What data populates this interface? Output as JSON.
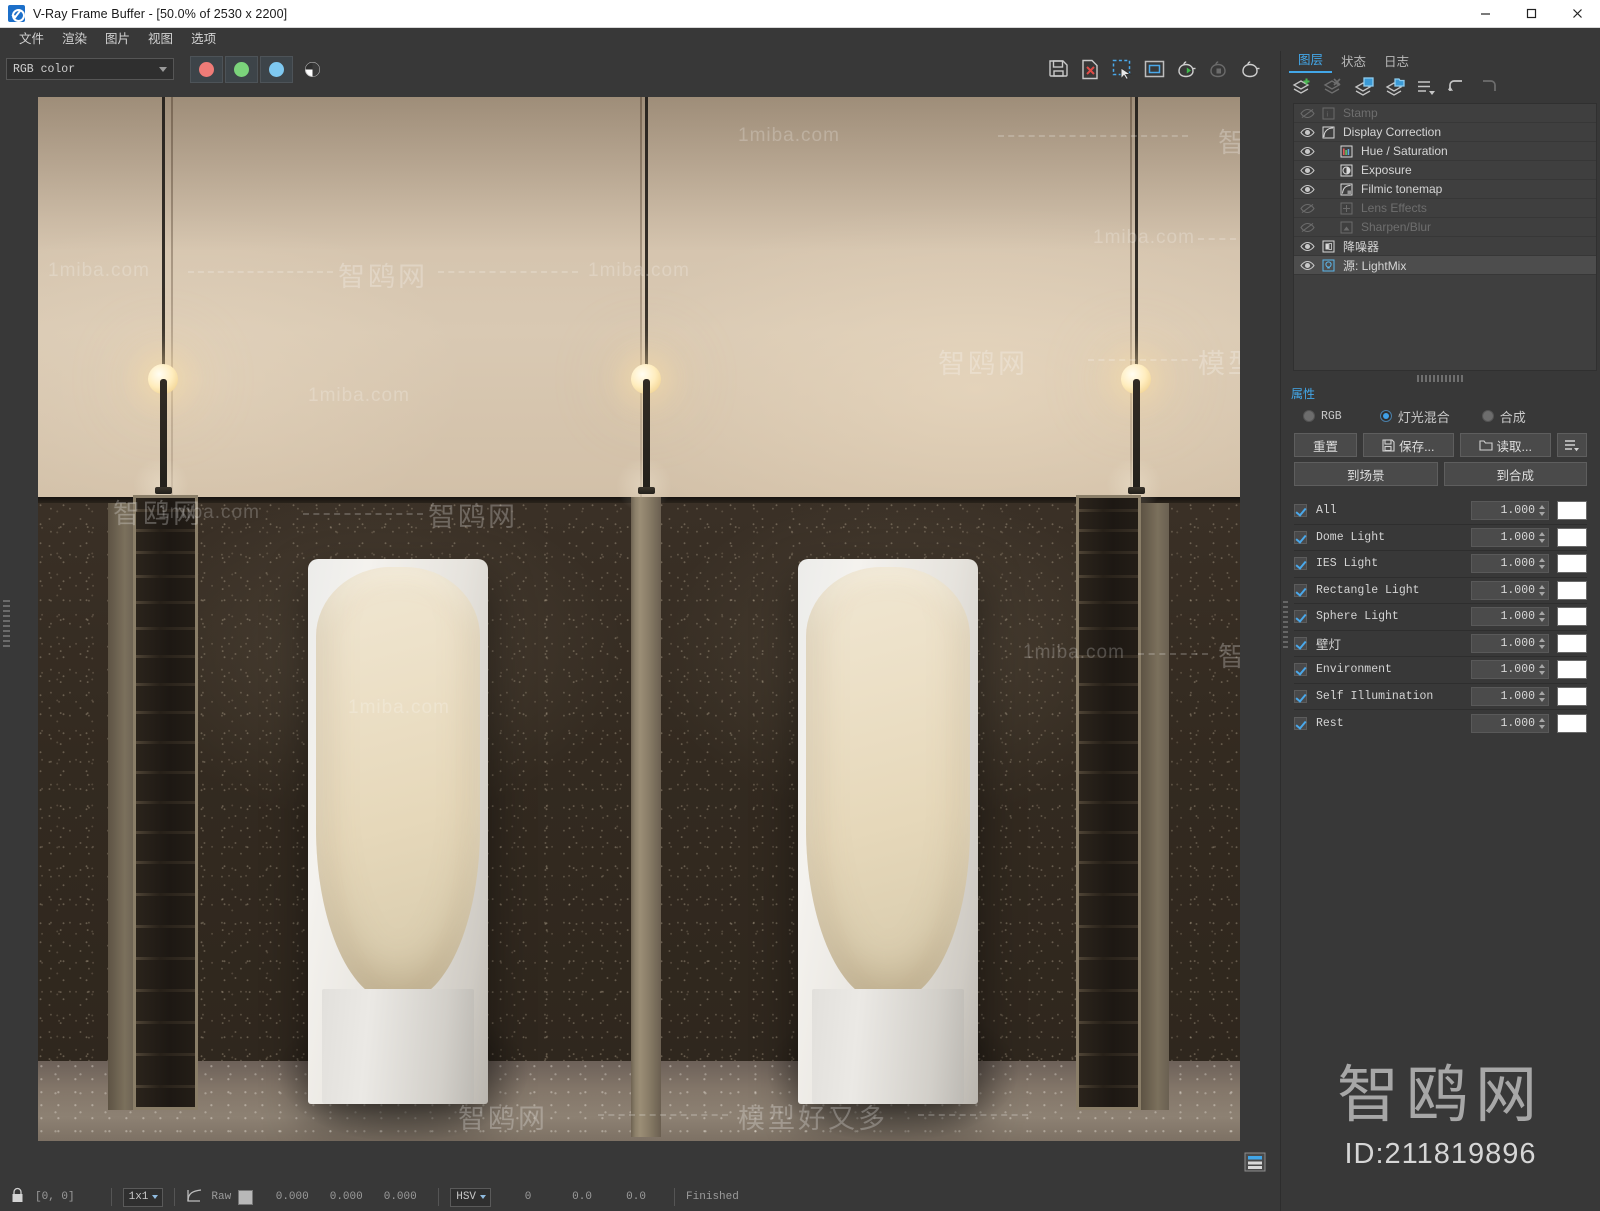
{
  "window": {
    "title": "V-Ray Frame Buffer - [50.0% of 2530 x 2200]",
    "icon": "vray-logo-icon",
    "minimize": "minimize-icon",
    "maximize": "maximize-icon",
    "close": "close-icon"
  },
  "menu": {
    "items": [
      "文件",
      "渲染",
      "图片",
      "视图",
      "选项"
    ]
  },
  "toolbar": {
    "channel_select": "RGB color",
    "channels": [
      {
        "name": "red-channel-button",
        "color": "#ef7b77"
      },
      {
        "name": "green-channel-button",
        "color": "#7bd37b"
      },
      {
        "name": "blue-channel-button",
        "color": "#7ec8f0"
      }
    ],
    "alpha_button": "alpha-channel-icon",
    "right_icons": [
      "save-image-icon",
      "save-image-as-icon",
      "region-render-icon",
      "show-vfb-icon",
      "render-last-icon",
      "render-paused-icon",
      "render-icon"
    ]
  },
  "render": {
    "watermarks_latin": [
      "1miba.com",
      "1miba.com",
      "1miba.com",
      "1miba.com",
      "1miba.com",
      "1miba.com",
      "1miba.com",
      "1miba.com"
    ],
    "watermarks_cn": [
      "智鸥网",
      "智鸥网",
      "智鸥网",
      "智鸥网",
      "智鸥网"
    ],
    "tagline": "模型好又多"
  },
  "statusbar": {
    "lock_icon": "lock-icon",
    "coords": "[0, 0]",
    "sample_size": "1x1",
    "curve_icon": "color-curve-icon",
    "raw_label": "Raw",
    "raw_values": [
      "0.000",
      "0.000",
      "0.000"
    ],
    "color_mode": "HSV",
    "hsv_values": [
      "0",
      "0.0",
      "0.0"
    ],
    "state": "Finished",
    "history_icon": "render-history-icon"
  },
  "right_panel": {
    "tabs": [
      {
        "label": "图层",
        "active": true
      },
      {
        "label": "状态",
        "active": false
      },
      {
        "label": "日志",
        "active": false
      }
    ],
    "layer_tools": [
      "add-layer-icon",
      "remove-layer-icon",
      "save-layer-icon",
      "load-layer-icon",
      "layer-list-icon",
      "undo-icon",
      "redo-icon"
    ],
    "layers": [
      {
        "label": "Stamp",
        "icon": "stamp-icon",
        "enabled": false,
        "indent": 0,
        "selected": false
      },
      {
        "label": "Display Correction",
        "icon": "curve-icon",
        "enabled": true,
        "indent": 0,
        "selected": false
      },
      {
        "label": "Hue / Saturation",
        "icon": "hue-saturation-icon",
        "enabled": true,
        "indent": 1,
        "selected": false
      },
      {
        "label": "Exposure",
        "icon": "exposure-icon",
        "enabled": true,
        "indent": 1,
        "selected": false
      },
      {
        "label": "Filmic tonemap",
        "icon": "filmic-tonemap-icon",
        "enabled": true,
        "indent": 1,
        "selected": false
      },
      {
        "label": "Lens Effects",
        "icon": "lens-effects-icon",
        "enabled": false,
        "indent": 1,
        "selected": false
      },
      {
        "label": "Sharpen/Blur",
        "icon": "sharpen-blur-icon",
        "enabled": false,
        "indent": 1,
        "selected": false
      },
      {
        "label": "降噪器",
        "icon": "denoiser-icon",
        "enabled": true,
        "indent": 0,
        "selected": false
      },
      {
        "label": "源: LightMix",
        "icon": "lightmix-icon",
        "enabled": true,
        "indent": 0,
        "selected": true
      }
    ],
    "properties": {
      "tab_label": "属性",
      "modes": [
        {
          "label": "RGB",
          "selected": false,
          "mono": true
        },
        {
          "label": "灯光混合",
          "selected": true,
          "mono": false
        },
        {
          "label": "合成",
          "selected": false,
          "mono": false
        }
      ],
      "buttons": {
        "reset": "重置",
        "save": "保存...",
        "load": "读取...",
        "menu_icon": "list-menu-icon",
        "to_scene": "到场景",
        "to_composite": "到合成"
      },
      "lights": [
        {
          "name": "All",
          "checked": true,
          "value": "1.000",
          "color": "#ffffff",
          "mono": true
        },
        {
          "name": "Dome Light",
          "checked": true,
          "value": "1.000",
          "color": "#ffffff",
          "mono": true
        },
        {
          "name": "IES Light",
          "checked": true,
          "value": "1.000",
          "color": "#ffffff",
          "mono": true
        },
        {
          "name": "Rectangle Light",
          "checked": true,
          "value": "1.000",
          "color": "#ffffff",
          "mono": true
        },
        {
          "name": "Sphere Light",
          "checked": true,
          "value": "1.000",
          "color": "#ffffff",
          "mono": true
        },
        {
          "name": "壁灯",
          "checked": true,
          "value": "1.000",
          "color": "#ffffff",
          "mono": false
        },
        {
          "name": "Environment",
          "checked": true,
          "value": "1.000",
          "color": "#ffffff",
          "mono": true
        },
        {
          "name": "Self Illumination",
          "checked": true,
          "value": "1.000",
          "color": "#ffffff",
          "mono": true
        },
        {
          "name": "Rest",
          "checked": true,
          "value": "1.000",
          "color": "#ffffff",
          "mono": true
        }
      ]
    },
    "brand": {
      "name": "智鸥网",
      "id": "ID:211819896"
    }
  },
  "colors": {
    "accent": "#43a7e8",
    "panel_bg": "#383838",
    "list_bg": "#3f3f3f",
    "wall_upper": "#d4c3ad",
    "wall_lower": "#332a20"
  }
}
